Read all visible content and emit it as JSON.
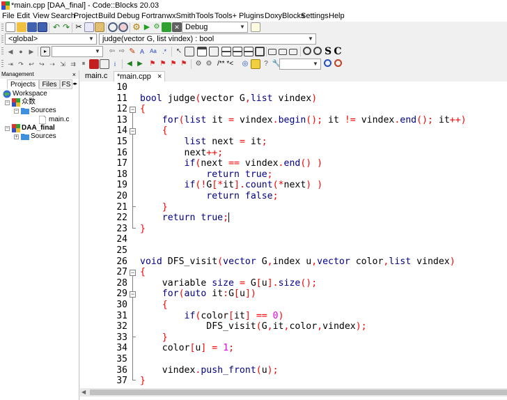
{
  "window": {
    "title": "*main.cpp [DAA_final] - Code::Blocks 20.03"
  },
  "menu": [
    "File",
    "Edit",
    "View",
    "Search",
    "Project",
    "Build",
    "Debug",
    "Fortran",
    "wxSmith",
    "Tools",
    "Tools+",
    "Plugins",
    "DoxyBlocks",
    "Settings",
    "Help"
  ],
  "toolbar": {
    "build_target": "Debug",
    "scope": "<global>",
    "function": "judge(vector G, list vindex) : bool",
    "doxy_comment": "/** *<",
    "s_label": "S",
    "c_label": "C"
  },
  "management": {
    "title": "Management",
    "close": "×",
    "tabs": [
      "Projects",
      "Files",
      "FS"
    ],
    "workspace_label": "Workspace",
    "project1": "众数",
    "sources1": "Sources",
    "file1": "main.c",
    "project2": "DAA_final",
    "sources2": "Sources"
  },
  "editor": {
    "tabs": [
      {
        "label": "main.c",
        "close": ""
      },
      {
        "label": "*main.cpp",
        "close": "×"
      }
    ],
    "line_numbers": [
      "10",
      "11",
      "12",
      "13",
      "14",
      "15",
      "16",
      "17",
      "18",
      "19",
      "20",
      "21",
      "22",
      "23",
      "24",
      "25",
      "26",
      "27",
      "28",
      "29",
      "30",
      "31",
      "32",
      "33",
      "34",
      "35",
      "36",
      "37"
    ],
    "lines": [
      "",
      "bool judge(vector G,list vindex)",
      "{",
      "    for(list it = vindex.begin(); it != vindex.end(); it++)",
      "    {",
      "        list next = it;",
      "        next++;",
      "        if(next == vindex.end() )",
      "            return true;",
      "        if(!G[*it].count(*next) )",
      "            return false;",
      "    }",
      "    return true;",
      "}",
      "",
      "",
      "void DFS_visit(vector G,index u,vector color,list vindex)",
      "{",
      "    variable size = G[u].size();",
      "    for(auto it:G[u])",
      "    {",
      "        if(color[it] == 0)",
      "            DFS_visit(G,it,color,vindex);",
      "    }",
      "    color[u] = 1;",
      "",
      "    vindex.push_front(u);",
      "}"
    ]
  },
  "colors": {
    "keyword": "#00008b",
    "operator": "#ff0000",
    "number": "#f000f0"
  }
}
